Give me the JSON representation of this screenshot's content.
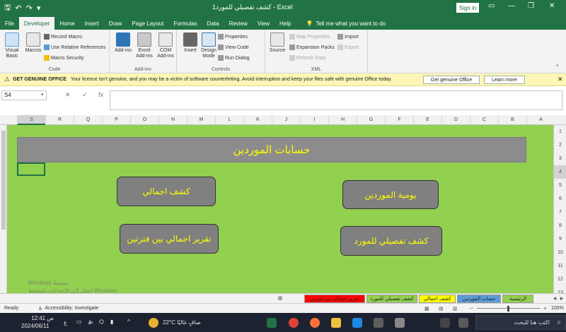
{
  "window": {
    "title": "كشف تفصيلي للمورد1  -  Excel",
    "signin": "Sign in"
  },
  "tabs": [
    "File",
    "Developer",
    "Home",
    "Insert",
    "Draw",
    "Page Layout",
    "Formulas",
    "Data",
    "Review",
    "View",
    "Help"
  ],
  "active_tab": "Developer",
  "tell_me": "Tell me what you want to do",
  "ribbon": {
    "code": {
      "label": "Code",
      "visual_basic": "Visual Basic",
      "macros": "Macros",
      "record_macro": "Record Macro",
      "relative_refs": "Use Relative References",
      "macro_security": "Macro Security"
    },
    "addins": {
      "label": "Add-ins",
      "addins": "Add-ins",
      "excel_addins": "Excel Add-ins",
      "com_addins": "COM Add-ins"
    },
    "controls": {
      "label": "Controls",
      "insert": "Insert",
      "design_mode": "Design Mode",
      "properties": "Properties",
      "view_code": "View Code",
      "run_dialog": "Run Dialog"
    },
    "xml": {
      "label": "XML",
      "source": "Source",
      "map_properties": "Map Properties",
      "expansion_packs": "Expansion Packs",
      "refresh_data": "Refresh Data",
      "import": "Import",
      "export": "Export"
    }
  },
  "message_bar": {
    "title": "GET GENUINE OFFICE",
    "text": "Your licence isn't genuine, and you may be a victim of software counterfeiting. Avoid interruption and keep your files safe with genuine Office today.",
    "button1": "Get genuine Office",
    "button2": "Learn more"
  },
  "formula_bar": {
    "name_box": "S4",
    "cancel": "✕",
    "enter": "✓",
    "fx": "fx",
    "value": ""
  },
  "columns": [
    "S",
    "R",
    "Q",
    "P",
    "O",
    "N",
    "M",
    "L",
    "K",
    "J",
    "I",
    "H",
    "G",
    "F",
    "E",
    "D",
    "C",
    "B",
    "A"
  ],
  "selected_column": "S",
  "rows": [
    "1",
    "2",
    "3",
    "4",
    "5",
    "6",
    "7",
    "8",
    "9",
    "10",
    "11",
    "12",
    "13"
  ],
  "selected_row": "4",
  "sheet": {
    "banner": "حسابات الموردين",
    "buttons": {
      "summary": "كشف اجمالي",
      "daily": "يومية الموردين",
      "period_report": "تقرير اجمالي بين فترتين",
      "detail": "كشف تفصيلي للمورد"
    },
    "watermark_line1": "Windows تنشيط",
    "watermark_line2": "انتقل إلى الإعدادات لتنشيط Windows"
  },
  "sheet_tabs": [
    {
      "label": "الرئيسية",
      "color": "#92d050"
    },
    {
      "label": "حساب الموردين",
      "color": "#5b9bd5"
    },
    {
      "label": "كشف اجمالي",
      "color": "#ffff00"
    },
    {
      "label": "كشف تفصيلي للمورد",
      "color": "#92d050"
    },
    {
      "label": "تقرير اجمالي بين فترتين",
      "color": "#ff0000"
    }
  ],
  "status": {
    "ready": "Ready",
    "accessibility": "Accessibility: Investigate",
    "zoom": "100%"
  },
  "taskbar": {
    "time": "12:41 ص",
    "date": "2024/06/11",
    "weather": "22°C  صافٍ غالبًا",
    "search": "اكتب هنا للبحث",
    "lang": "ع"
  },
  "colors": {
    "excel_green": "#217346",
    "sheet_fill": "#92d050",
    "banner_fill": "#8c8c8c",
    "button_text": "#ffff00"
  }
}
